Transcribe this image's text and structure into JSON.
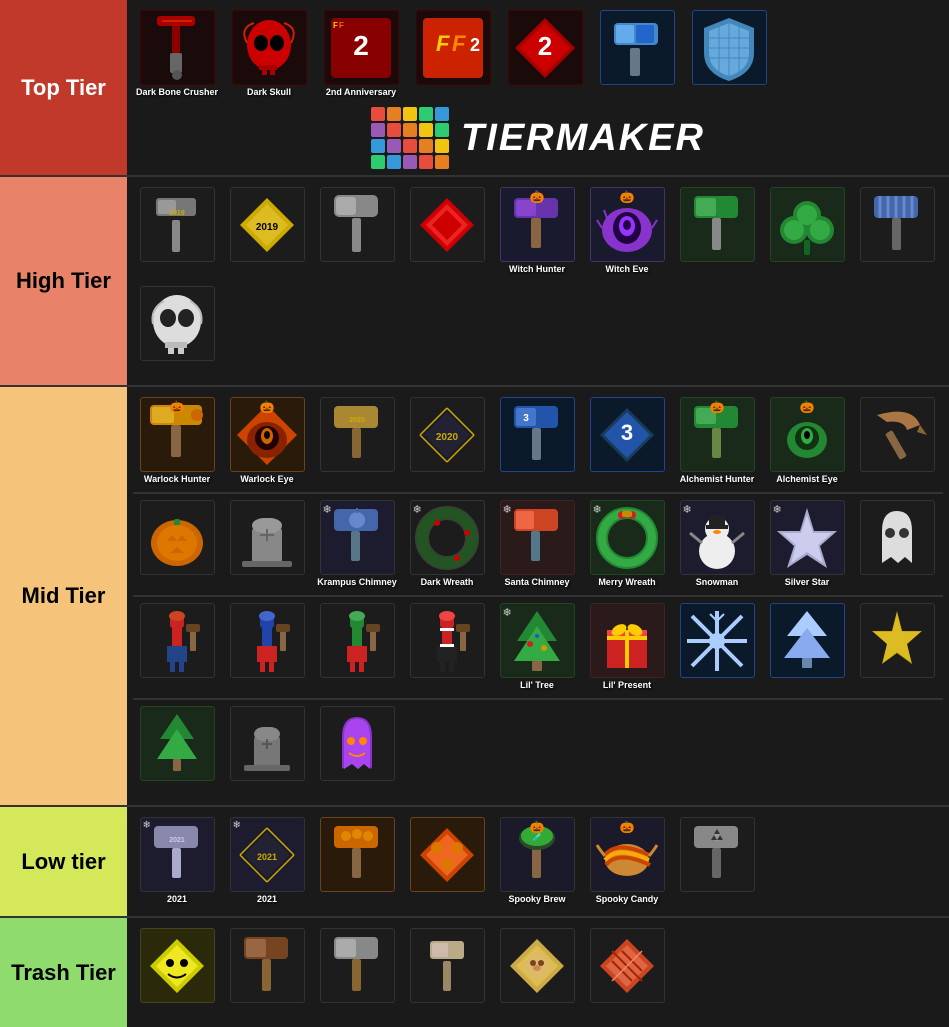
{
  "tiers": [
    {
      "id": "top",
      "label": "Top Tier",
      "labelClass": "top-tier-label",
      "items": [
        {
          "name": "Dark Bone Crusher",
          "emoji": "🔨",
          "color": "#8B0000",
          "hasLabel": true
        },
        {
          "name": "Dark Skull",
          "emoji": "💀",
          "color": "#cc0000",
          "hasLabel": true
        },
        {
          "name": "2nd Anniversary",
          "emoji": "🎯",
          "color": "#cc0000",
          "hasLabel": true
        },
        {
          "name": "FF2",
          "emoji": "🔨",
          "color": "#cc2200",
          "hasLabel": false
        },
        {
          "name": "2",
          "emoji": "💎",
          "color": "#990000",
          "hasLabel": false
        },
        {
          "name": "Hammer",
          "emoji": "🔨",
          "color": "#4488cc",
          "hasLabel": false
        },
        {
          "name": "Shield",
          "emoji": "🛡️",
          "color": "#44aacc",
          "hasLabel": false
        },
        {
          "name": "Logo",
          "special": "tiermaker",
          "hasLabel": false
        }
      ]
    },
    {
      "id": "high",
      "label": "High Tier",
      "labelClass": "high-tier-label",
      "items": [
        {
          "name": "2019 Hammer",
          "emoji": "🔨",
          "color": "#888",
          "hasLabel": false
        },
        {
          "name": "2019 Diamond",
          "emoji": "🔶",
          "color": "#ccaa00",
          "hasLabel": false
        },
        {
          "name": "Grey Hammer",
          "emoji": "🔨",
          "color": "#777",
          "hasLabel": false
        },
        {
          "name": "Red Diamond",
          "emoji": "🔶",
          "color": "#cc0000",
          "hasLabel": false
        },
        {
          "name": "Witch Hunter",
          "emoji": "🔨",
          "color": "#6600cc",
          "hasLabel": true,
          "pumpkin": true
        },
        {
          "name": "Witch Eye",
          "emoji": "👁️",
          "color": "#6600cc",
          "hasLabel": true,
          "pumpkin": true
        },
        {
          "name": "Green Hammer",
          "emoji": "🔨",
          "color": "#228822",
          "hasLabel": false
        },
        {
          "name": "Clover",
          "emoji": "🍀",
          "color": "#228822",
          "hasLabel": false
        },
        {
          "name": "Striped Hammer",
          "emoji": "🔨",
          "color": "#4466aa",
          "hasLabel": false
        },
        {
          "name": "Skull",
          "emoji": "💀",
          "color": "#cccccc",
          "hasLabel": false,
          "newRow": true
        }
      ]
    },
    {
      "id": "mid",
      "label": "Mid Tier",
      "labelClass": "mid-tier-label",
      "items": [
        {
          "name": "Warlock Hunter",
          "emoji": "🍬",
          "color": "#cc8800",
          "hasLabel": true,
          "pumpkin": true
        },
        {
          "name": "Warlock Eye",
          "emoji": "👁️",
          "color": "#cc4400",
          "hasLabel": true,
          "pumpkin": true
        },
        {
          "name": "2020 Hammer",
          "emoji": "🔨",
          "color": "#aa8833",
          "hasLabel": false
        },
        {
          "name": "2020 Diamond",
          "emoji": "🔶",
          "color": "#ccaa00",
          "hasLabel": false
        },
        {
          "name": "Blue Hammer",
          "emoji": "🔨",
          "color": "#2266cc",
          "hasLabel": false
        },
        {
          "name": "3 Diamond",
          "emoji": "💎",
          "color": "#2288cc",
          "hasLabel": false
        },
        {
          "name": "Alchemist Hunter",
          "emoji": "🔨",
          "color": "#228833",
          "hasLabel": true,
          "pumpkin": true
        },
        {
          "name": "Alchemist Eye",
          "emoji": "👁️",
          "color": "#228833",
          "hasLabel": true,
          "pumpkin": true
        },
        {
          "name": "Brown Hammer",
          "emoji": "🔨",
          "color": "#884422",
          "hasLabel": false
        },
        {
          "name": "Pumpkin",
          "emoji": "🎃",
          "color": "#cc6600",
          "hasLabel": false,
          "newRow": true
        },
        {
          "name": "Gravestone",
          "emoji": "🪦",
          "color": "#888",
          "hasLabel": false
        },
        {
          "name": "Krampus Chimney",
          "emoji": "🔨",
          "color": "#6688aa",
          "hasLabel": true,
          "snowflake": true
        },
        {
          "name": "Dark Wreath",
          "emoji": "🌑",
          "color": "#334433",
          "hasLabel": true,
          "snowflake": true
        },
        {
          "name": "Santa Chimney",
          "emoji": "🔨",
          "color": "#cc4422",
          "hasLabel": true,
          "snowflake": true
        },
        {
          "name": "Merry Wreath",
          "emoji": "🌿",
          "color": "#228833",
          "hasLabel": true,
          "snowflake": true
        },
        {
          "name": "Snowman",
          "emoji": "⛄",
          "color": "#fff",
          "hasLabel": true,
          "snowflake": true
        },
        {
          "name": "Silver Star",
          "emoji": "⭐",
          "color": "#aaaacc",
          "hasLabel": true,
          "snowflake": true
        },
        {
          "name": "Ghost",
          "emoji": "👻",
          "color": "#fff",
          "hasLabel": false
        },
        {
          "name": "Nutcracker1",
          "emoji": "🪆",
          "color": "#cc4422",
          "hasLabel": false,
          "newRow": true
        },
        {
          "name": "Nutcracker2",
          "emoji": "🔨",
          "color": "#4488cc",
          "hasLabel": false
        },
        {
          "name": "Nutcracker3",
          "emoji": "🪆",
          "color": "#228833",
          "hasLabel": false
        },
        {
          "name": "Nutcracker4",
          "emoji": "🪆",
          "color": "#cc2222",
          "hasLabel": false
        },
        {
          "name": "Lil Tree",
          "emoji": "🎄",
          "color": "#228833",
          "hasLabel": true,
          "snowflake": true
        },
        {
          "name": "Lil Present",
          "emoji": "🎁",
          "color": "#cc2222",
          "hasLabel": true
        },
        {
          "name": "Snowflake",
          "emoji": "❄️",
          "color": "#aaccff",
          "hasLabel": false
        },
        {
          "name": "Ice Tree",
          "emoji": "🌲",
          "color": "#aaccff",
          "hasLabel": false
        },
        {
          "name": "Gold Star",
          "emoji": "⭐",
          "color": "#ccaa00",
          "hasLabel": false
        },
        {
          "name": "Pine Tree",
          "emoji": "🌲",
          "color": "#228833",
          "hasLabel": false,
          "newRow": true
        },
        {
          "name": "Gravestone2",
          "emoji": "⚰️",
          "color": "#666",
          "hasLabel": false
        },
        {
          "name": "Purple Ghost",
          "emoji": "👻",
          "color": "#8833cc",
          "hasLabel": false
        }
      ]
    },
    {
      "id": "low",
      "label": "Low tier",
      "labelClass": "low-tier-label",
      "items": [
        {
          "name": "2021 Hammer",
          "emoji": "🔨",
          "color": "#aaaacc",
          "hasLabel": true,
          "snowflake": true
        },
        {
          "name": "2021 Diamond",
          "emoji": "🔶",
          "color": "#ccaa00",
          "hasLabel": true,
          "snowflake": true
        },
        {
          "name": "Pumpkin Hammer",
          "emoji": "🔨",
          "color": "#cc6600",
          "hasLabel": false
        },
        {
          "name": "Pumpkin Diamond",
          "emoji": "🔶",
          "color": "#cc4400",
          "hasLabel": false
        },
        {
          "name": "Spooky Brew",
          "emoji": "🍵",
          "color": "#44cc44",
          "hasLabel": true,
          "pumpkin": true
        },
        {
          "name": "Spooky Candy",
          "emoji": "🍬",
          "color": "#cc8833",
          "hasLabel": true,
          "pumpkin": true
        },
        {
          "name": "Nuclear Hammer",
          "emoji": "🔨",
          "color": "#888",
          "hasLabel": false
        }
      ]
    },
    {
      "id": "trash",
      "label": "Trash Tier",
      "labelClass": "trash-tier-label",
      "items": [
        {
          "name": "Yellow Diamond",
          "emoji": "🔶",
          "color": "#cccc00",
          "hasLabel": false
        },
        {
          "name": "Brown Hammer2",
          "emoji": "🔨",
          "color": "#884422",
          "hasLabel": false
        },
        {
          "name": "Grey Hammer2",
          "emoji": "🔨",
          "color": "#888",
          "hasLabel": false
        },
        {
          "name": "Small Hammer",
          "emoji": "🔨",
          "color": "#998866",
          "hasLabel": false
        },
        {
          "name": "Doge Diamond",
          "emoji": "🐕",
          "color": "#ccaa44",
          "hasLabel": false
        },
        {
          "name": "Pattern Diamond",
          "emoji": "🎨",
          "color": "#cc4422",
          "hasLabel": false
        }
      ]
    }
  ],
  "logo": {
    "title": "TiERMAKER",
    "gridColors": [
      "#e74c3c",
      "#e67e22",
      "#f1c40f",
      "#2ecc71",
      "#3498db",
      "#9b59b6",
      "#e74c3c",
      "#e67e22",
      "#f1c40f",
      "#2ecc71",
      "#3498db",
      "#9b59b6",
      "#e74c3c",
      "#e67e22",
      "#f1c40f",
      "#2ecc71",
      "#3498db",
      "#9b59b6",
      "#e74c3c",
      "#e67e22"
    ]
  }
}
